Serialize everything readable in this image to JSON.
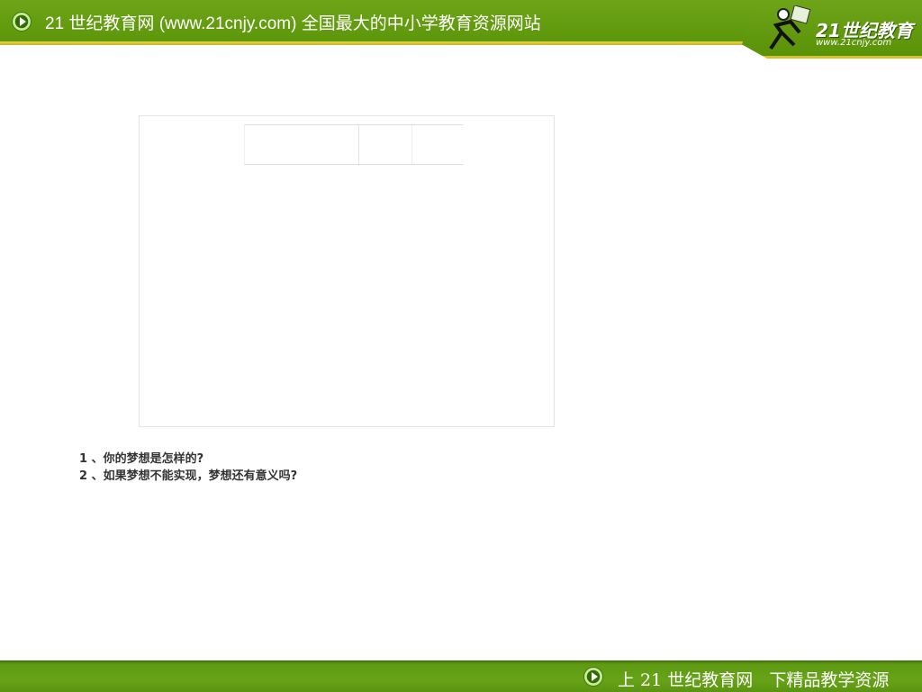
{
  "header": {
    "title": "21 世纪教育网 (www.21cnjy.com)  全国最大的中小学教育资源网站",
    "logo_text": "21世纪教育",
    "logo_url": "www.21cnjy.com"
  },
  "questions": [
    "1 、你的梦想是怎样的?",
    "2 、如果梦想不能实现，梦想还有意义吗?"
  ],
  "footer": {
    "text": "上 21 世纪教育网   下精品教学资源"
  },
  "colors": {
    "brand_green": "#5f9a0c",
    "accent_yellow": "#d8c030"
  }
}
